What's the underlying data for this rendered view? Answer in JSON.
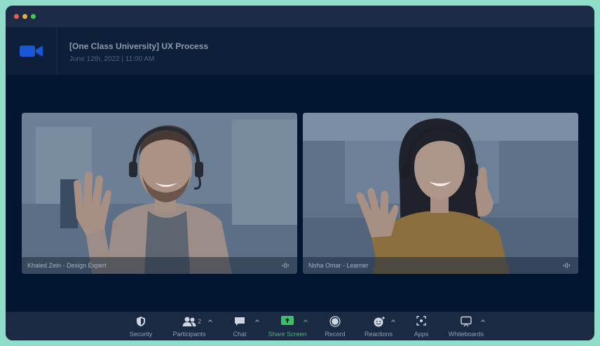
{
  "meeting": {
    "title": "[One Class University] UX Process",
    "datetime": "June 12th, 2022 | 11:00 AM"
  },
  "participants_video": [
    {
      "name": "Khaled Zein - Design Expert"
    },
    {
      "name": "Noha Omar - Learner"
    }
  ],
  "toolbar": {
    "security": "Security",
    "participants": "Participants",
    "participants_count": "2",
    "chat": "Chat",
    "share_screen": "Share Screen",
    "record": "Record",
    "reactions": "Reactions",
    "apps": "Apps",
    "whiteboards": "Whiteboards"
  },
  "colors": {
    "background_frame": "#8fdcc8",
    "window_bg": "#021631",
    "brand_blue": "#1a56d6",
    "share_green": "#3ec06a"
  },
  "icons": [
    "video-camera-icon",
    "shield-icon",
    "people-icon",
    "chat-bubble-icon",
    "share-screen-icon",
    "record-icon",
    "reaction-smile-icon",
    "apps-icon",
    "whiteboard-icon",
    "audio-wave-icon",
    "caret-up-icon"
  ]
}
